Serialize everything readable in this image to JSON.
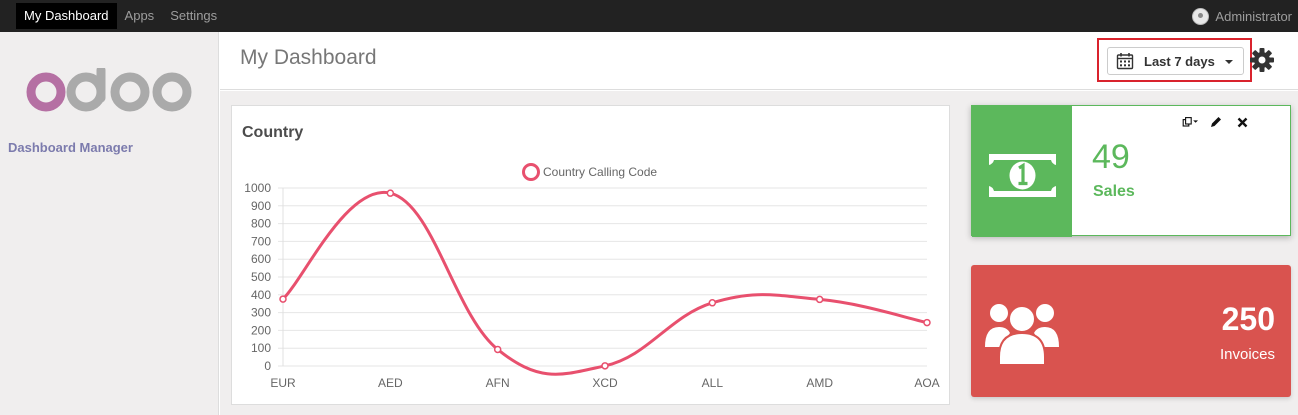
{
  "topbar": {
    "menu": [
      "My Dashboard",
      "Apps",
      "Settings"
    ],
    "user": "Administrator"
  },
  "sidebar": {
    "logo_text": "odoo",
    "title": "Dashboard Manager"
  },
  "control_panel": {
    "title": "My Dashboard",
    "period_label": "Last 7 days"
  },
  "chart_card": {
    "title": "Country"
  },
  "chart_data": {
    "type": "line",
    "title": "Country",
    "categories": [
      "EUR",
      "AED",
      "AFN",
      "XCD",
      "ALL",
      "AMD",
      "AOA"
    ],
    "series": [
      {
        "name": "Country Calling Code",
        "values": [
          376,
          971,
          93,
          1,
          355,
          374,
          244
        ]
      }
    ],
    "ylim": [
      0,
      1000
    ],
    "yticks": [
      0,
      100,
      200,
      300,
      400,
      500,
      600,
      700,
      800,
      900,
      1000
    ],
    "grid": true,
    "legend": "top",
    "color": "#e8506e"
  },
  "tiles": {
    "sales": {
      "value": "49",
      "label": "Sales",
      "color": "#5cb85c",
      "icon": "money-icon"
    },
    "invoices": {
      "value": "250",
      "label": "Invoices",
      "color": "#d9534f",
      "icon": "users-icon"
    }
  }
}
